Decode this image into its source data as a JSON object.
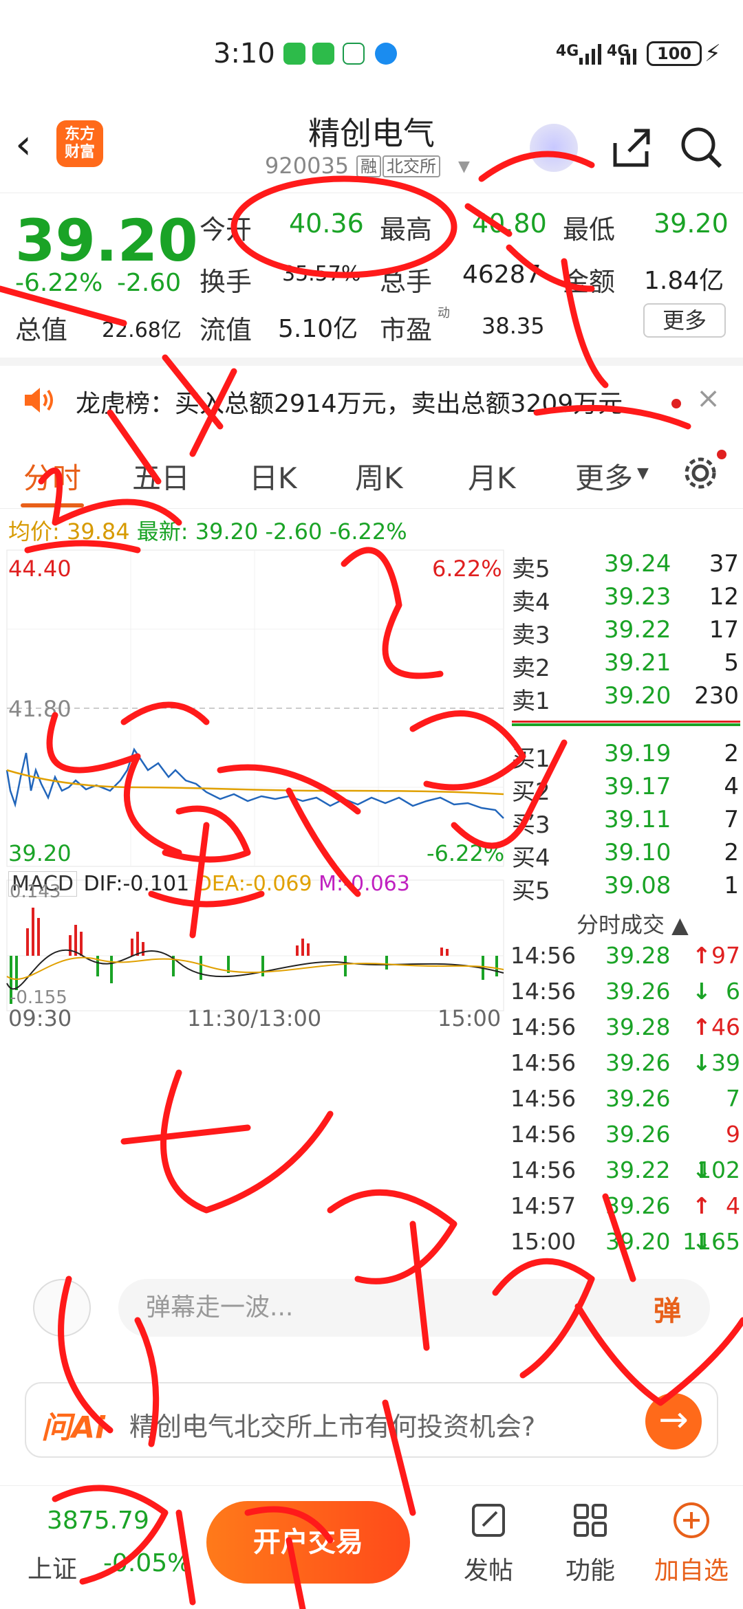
{
  "status": {
    "time": "3:10",
    "signal1": "4G",
    "signal2": "4G",
    "battery": "100"
  },
  "header": {
    "back": "‹",
    "logo_line1": "东方",
    "logo_line2": "财富",
    "title": "精创电气",
    "code": "920035",
    "tag_margin": "融",
    "tag_exchange": "北交所"
  },
  "quote": {
    "price": "39.20",
    "pct": "-6.22%",
    "chg": "-2.60",
    "open_label": "今开",
    "open": "40.36",
    "high_label": "最高",
    "high": "40.80",
    "low_label": "最低",
    "low": "39.20",
    "turnover_label": "换手",
    "turnover": "35.57%",
    "volume_label": "总手",
    "volume": "46287",
    "amount_label": "金额",
    "amount": "1.84亿",
    "mktcap_label": "总值",
    "mktcap": "22.68亿",
    "float_label": "流值",
    "float": "5.10亿",
    "pe_label": "市盈",
    "pe_tag": "动",
    "pe": "38.35",
    "more": "更多"
  },
  "lhb": {
    "text": "龙虎榜：买入总额2914万元，卖出总额3209万元"
  },
  "tabs": [
    "分时",
    "五日",
    "日K",
    "周K",
    "月K",
    "更多"
  ],
  "avgline": {
    "avg_label": "均价:",
    "avg": "39.84",
    "last_label": "最新:",
    "last": "39.20",
    "chg": "-2.60",
    "pct": "-6.22%"
  },
  "chart": {
    "ymax": "44.40",
    "ymax_pct": "6.22%",
    "ymid": "41.80",
    "ymin": "39.20",
    "ymin_pct": "-6.22%",
    "macd_label": "MACD",
    "dif": "DIF:-0.101",
    "dea": "DEA:-0.069",
    "m": "M:-0.063",
    "macd_top": "0.143",
    "macd_bot": "-0.155",
    "x_start": "09:30",
    "x_mid": "11:30/13:00",
    "x_end": "15:00"
  },
  "orderbook": {
    "asks": [
      {
        "label": "卖5",
        "price": "39.24",
        "vol": "37"
      },
      {
        "label": "卖4",
        "price": "39.23",
        "vol": "12"
      },
      {
        "label": "卖3",
        "price": "39.22",
        "vol": "17"
      },
      {
        "label": "卖2",
        "price": "39.21",
        "vol": "5"
      },
      {
        "label": "卖1",
        "price": "39.20",
        "vol": "230"
      }
    ],
    "bids": [
      {
        "label": "买1",
        "price": "39.19",
        "vol": "2"
      },
      {
        "label": "买2",
        "price": "39.17",
        "vol": "4"
      },
      {
        "label": "买3",
        "price": "39.11",
        "vol": "7"
      },
      {
        "label": "买4",
        "price": "39.10",
        "vol": "2"
      },
      {
        "label": "买5",
        "price": "39.08",
        "vol": "1"
      }
    ]
  },
  "ticks": {
    "title": "分时成交 ▲",
    "rows": [
      {
        "t": "14:56",
        "p": "39.28",
        "a": "↑",
        "v": "97",
        "dir": "up"
      },
      {
        "t": "14:56",
        "p": "39.26",
        "a": "↓",
        "v": "6",
        "dir": "down"
      },
      {
        "t": "14:56",
        "p": "39.28",
        "a": "↑",
        "v": "46",
        "dir": "up"
      },
      {
        "t": "14:56",
        "p": "39.26",
        "a": "↓",
        "v": "39",
        "dir": "down"
      },
      {
        "t": "14:56",
        "p": "39.26",
        "a": "",
        "v": "7",
        "dir": "none"
      },
      {
        "t": "14:56",
        "p": "39.26",
        "a": "",
        "v": "9",
        "dir": "up"
      },
      {
        "t": "14:56",
        "p": "39.22",
        "a": "↓",
        "v": "102",
        "dir": "down"
      },
      {
        "t": "14:57",
        "p": "39.26",
        "a": "↑",
        "v": "4",
        "dir": "up"
      },
      {
        "t": "15:00",
        "p": "39.20",
        "a": "↓",
        "v": "1165",
        "dir": "down"
      }
    ]
  },
  "comment": {
    "placeholder": "弹幕走一波...",
    "danmu": "弹"
  },
  "ai": {
    "logo": "问Ai",
    "text": "精创电气北交所上市有何投资机会?",
    "go": "→"
  },
  "bottombar": {
    "idx_val": "3875.79",
    "idx_name": "上证",
    "idx_pct": "-0.05%",
    "trade": "开户交易",
    "post": "发帖",
    "func": "功能",
    "add": "加自选"
  },
  "colors": {
    "green": "#1aa326",
    "red": "#e02020",
    "orange": "#e8601a",
    "scribble": "#ff1a1a"
  }
}
